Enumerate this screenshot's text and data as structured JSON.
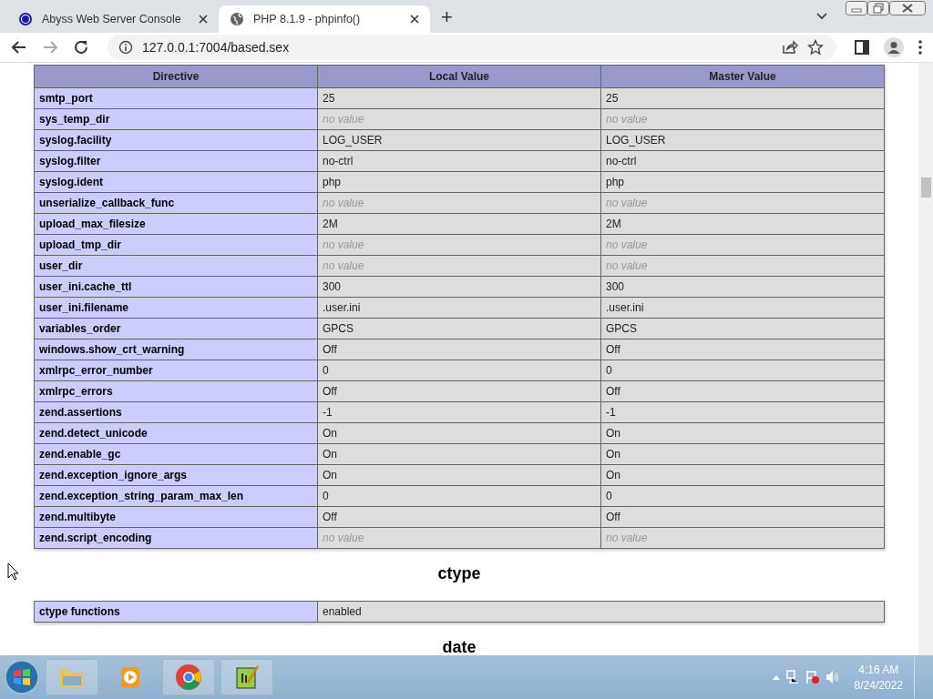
{
  "tabs": [
    {
      "title": "Abyss Web Server Console",
      "selected": false
    },
    {
      "title": "PHP 8.1.9 - phpinfo()",
      "selected": true
    }
  ],
  "new_tab": "+",
  "address": "127.0.0.1:7004/based.sex",
  "table": {
    "columns": [
      "Directive",
      "Local Value",
      "Master Value"
    ],
    "rows": [
      {
        "name": "smtp_port",
        "local": "25",
        "master": "25",
        "empty": false
      },
      {
        "name": "sys_temp_dir",
        "local": "no value",
        "master": "no value",
        "empty": true
      },
      {
        "name": "syslog.facility",
        "local": "LOG_USER",
        "master": "LOG_USER",
        "empty": false
      },
      {
        "name": "syslog.filter",
        "local": "no-ctrl",
        "master": "no-ctrl",
        "empty": false
      },
      {
        "name": "syslog.ident",
        "local": "php",
        "master": "php",
        "empty": false
      },
      {
        "name": "unserialize_callback_func",
        "local": "no value",
        "master": "no value",
        "empty": true
      },
      {
        "name": "upload_max_filesize",
        "local": "2M",
        "master": "2M",
        "empty": false
      },
      {
        "name": "upload_tmp_dir",
        "local": "no value",
        "master": "no value",
        "empty": true
      },
      {
        "name": "user_dir",
        "local": "no value",
        "master": "no value",
        "empty": true
      },
      {
        "name": "user_ini.cache_ttl",
        "local": "300",
        "master": "300",
        "empty": false
      },
      {
        "name": "user_ini.filename",
        "local": ".user.ini",
        "master": ".user.ini",
        "empty": false
      },
      {
        "name": "variables_order",
        "local": "GPCS",
        "master": "GPCS",
        "empty": false
      },
      {
        "name": "windows.show_crt_warning",
        "local": "Off",
        "master": "Off",
        "empty": false
      },
      {
        "name": "xmlrpc_error_number",
        "local": "0",
        "master": "0",
        "empty": false
      },
      {
        "name": "xmlrpc_errors",
        "local": "Off",
        "master": "Off",
        "empty": false
      },
      {
        "name": "zend.assertions",
        "local": "-1",
        "master": "-1",
        "empty": false
      },
      {
        "name": "zend.detect_unicode",
        "local": "On",
        "master": "On",
        "empty": false
      },
      {
        "name": "zend.enable_gc",
        "local": "On",
        "master": "On",
        "empty": false
      },
      {
        "name": "zend.exception_ignore_args",
        "local": "On",
        "master": "On",
        "empty": false
      },
      {
        "name": "zend.exception_string_param_max_len",
        "local": "0",
        "master": "0",
        "empty": false
      },
      {
        "name": "zend.multibyte",
        "local": "Off",
        "master": "Off",
        "empty": false
      },
      {
        "name": "zend.script_encoding",
        "local": "no value",
        "master": "no value",
        "empty": true
      }
    ]
  },
  "sections": [
    {
      "heading": "ctype",
      "rows": [
        {
          "name": "ctype functions",
          "value": "enabled"
        }
      ]
    },
    {
      "heading": "date"
    }
  ],
  "clock": {
    "time": "4:16 AM",
    "date": "8/24/2022"
  }
}
